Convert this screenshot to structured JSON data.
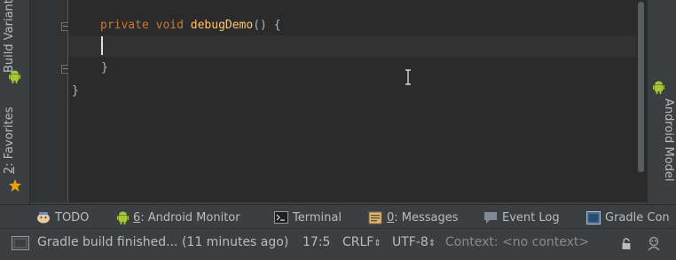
{
  "left_strip": {
    "build_variants": "Build Variants",
    "favorites_number": "2",
    "favorites_label": ": Favorites"
  },
  "right_strip": {
    "android_model": "Android Model"
  },
  "editor": {
    "line1": {
      "kw1": "private",
      "kw2": "void",
      "name": "debugDemo",
      "rest": "() {"
    },
    "line2": "}",
    "line3": "}"
  },
  "toolbar": {
    "todo": "TODO",
    "android_monitor_num": "6",
    "android_monitor_label": ": Android Monitor",
    "terminal": "Terminal",
    "messages_num": "0",
    "messages_label": ": Messages",
    "event_log": "Event Log",
    "gradle_console": "Gradle Con"
  },
  "status": {
    "message": "Gradle build finished... (11 minutes ago)",
    "position": "17:5",
    "line_separator": "CRLF",
    "encoding": "UTF-8",
    "context": "Context: <no context>"
  },
  "colors": {
    "android_green": "#a4c639",
    "favorites_star": "#e5a50a",
    "keyword": "#cc7832",
    "method": "#ffc66d"
  }
}
